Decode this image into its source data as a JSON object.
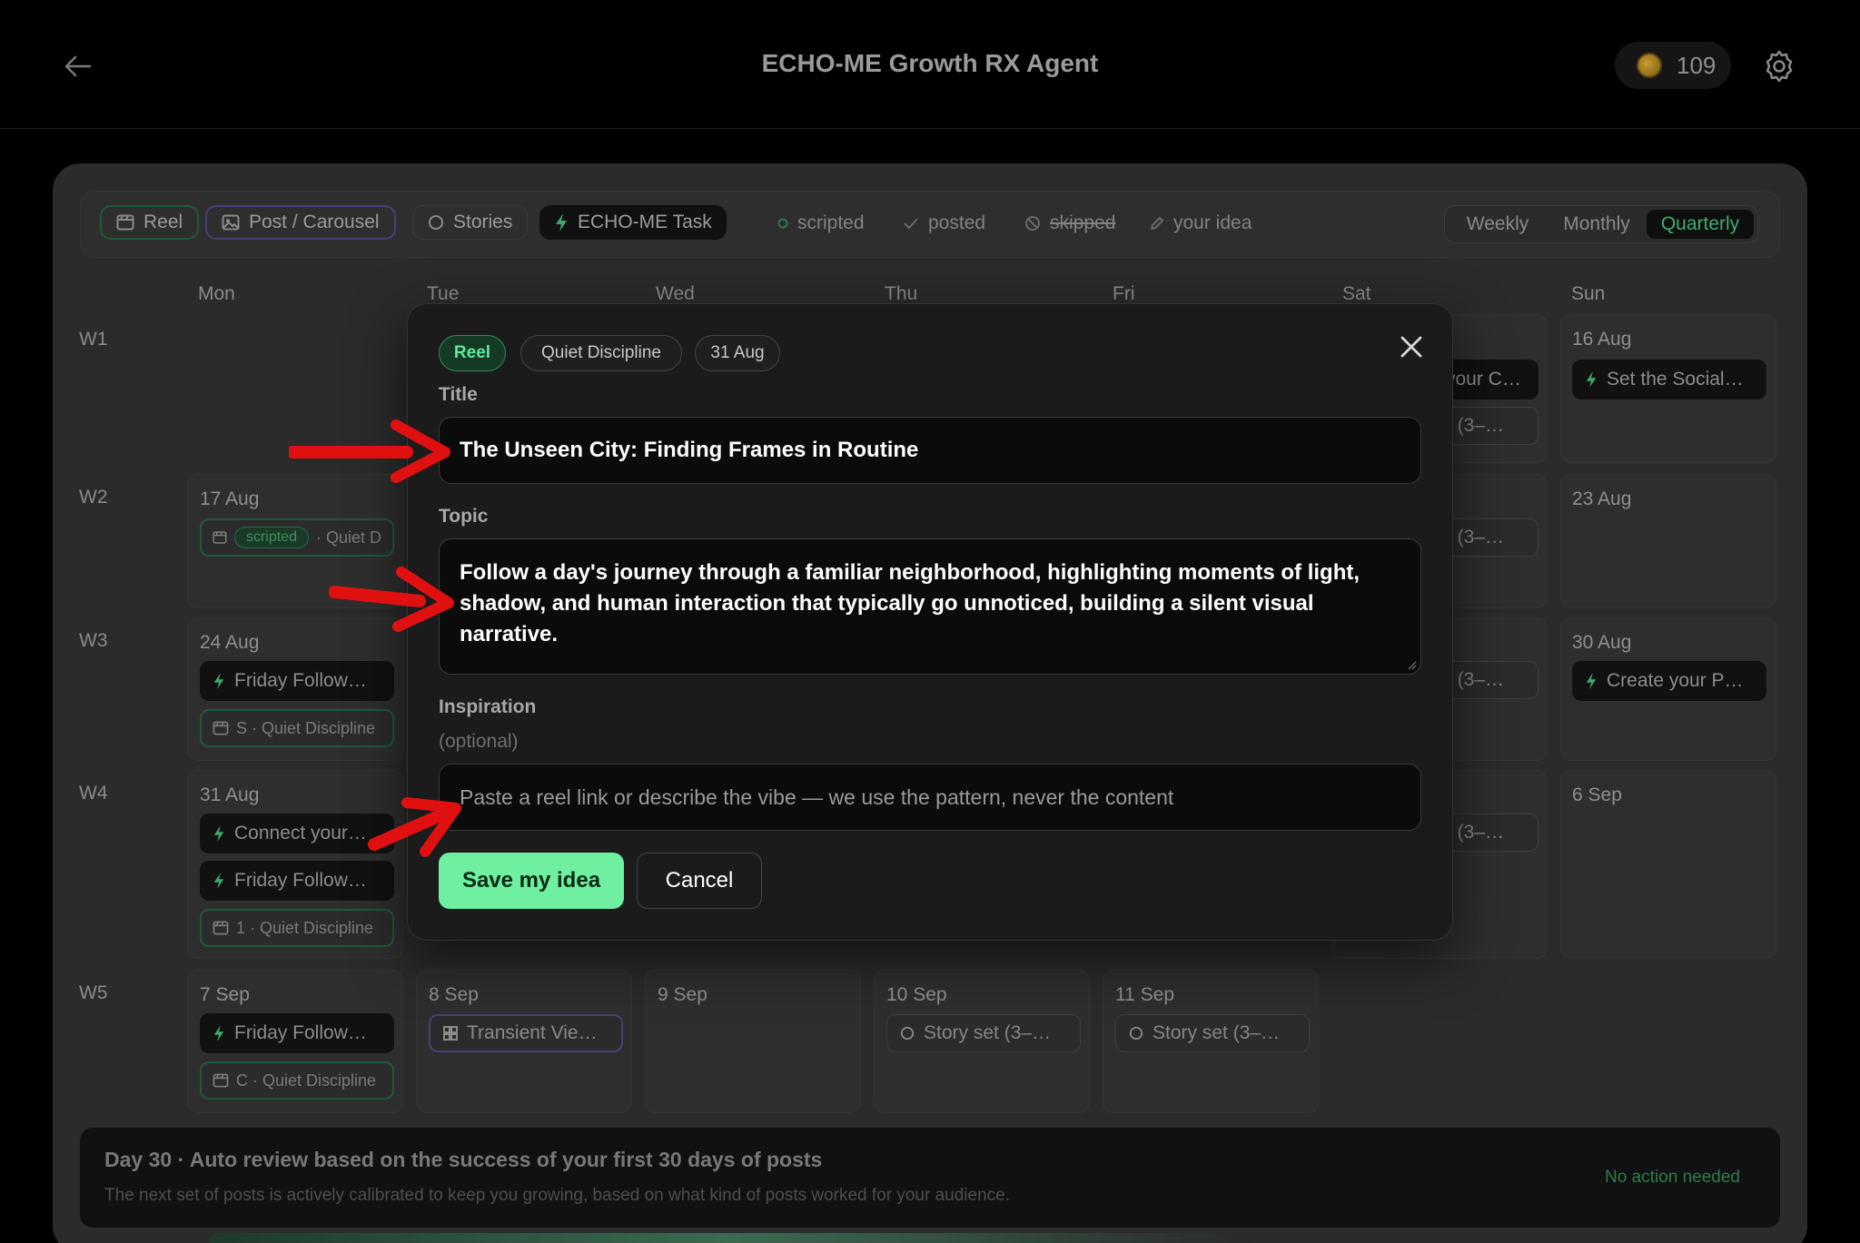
{
  "header": {
    "title": "ECHO-ME Growth RX Agent",
    "credits": "109"
  },
  "filters": {
    "types": [
      "Reel",
      "Post / Carousel",
      "Stories",
      "ECHO-ME Task"
    ],
    "legend": [
      "scripted",
      "posted",
      "skipped",
      "your idea"
    ],
    "views": [
      "Weekly",
      "Monthly",
      "Quarterly"
    ],
    "active_view": "Quarterly"
  },
  "calendar": {
    "days": [
      "Mon",
      "Tue",
      "Wed",
      "Thu",
      "Fri",
      "Sat",
      "Sun"
    ],
    "weeks": [
      "W1",
      "W2",
      "W3",
      "W4",
      "W5"
    ],
    "w1": {
      "sun_date": "16 Aug",
      "sun_task": "Set the Social…",
      "sat_task": "your C…",
      "sat_story": "t (3–…"
    },
    "w2": {
      "mon_date": "17 Aug",
      "mon_badge": "scripted",
      "mon_reel": "· Quiet D",
      "sat_story": "t (3–…",
      "sun_date": "23 Aug"
    },
    "w3": {
      "mon_date": "24 Aug",
      "mon_task": "Friday Follow…",
      "mon_reel": "S · Quiet Discipline",
      "sat_story": "t (3–…",
      "sun_date": "30 Aug",
      "sun_task": "Create your P…"
    },
    "w4": {
      "mon_date": "31 Aug",
      "mon_task1": "Connect your…",
      "mon_task2": "Friday Follow…",
      "mon_reel": "1 · Quiet Discipline",
      "sat_story": "t (3–…",
      "sun_date": "6 Sep"
    },
    "w5": {
      "mon_date": "7 Sep",
      "mon_task": "Friday Follow…",
      "mon_reel": "C · Quiet Discipline",
      "tue_date": "8 Sep",
      "tue_post": "Transient Vie…",
      "wed_date": "9 Sep",
      "thu_date": "10 Sep",
      "thu_story": "Story set (3–…",
      "fri_date": "11 Sep",
      "fri_story": "Story set (3–…"
    }
  },
  "banner": {
    "title": "Day 30 · Auto review based on the success of your first 30 days of posts",
    "subtitle": "The next set of posts is actively calibrated to keep you growing, based on what kind of posts worked for your audience.",
    "status": "No action needed"
  },
  "modal": {
    "tags": [
      "Reel",
      "Quiet Discipline",
      "31 Aug"
    ],
    "title_label": "Title",
    "title_value": "The Unseen City: Finding Frames in Routine",
    "topic_label": "Topic",
    "topic_value": "Follow a day's journey through a familiar neighborhood, highlighting moments of light, shadow, and human interaction that typically go unnoticed, building a silent visual narrative.",
    "inspiration_label": "Inspiration",
    "inspiration_optional": "(optional)",
    "inspiration_placeholder": "Paste a reel link or describe the vibe — we use the pattern, never the content",
    "save_label": "Save my idea",
    "cancel_label": "Cancel"
  },
  "colors": {
    "accent": "#6ef0a0",
    "annotation_arrow": "#e01010"
  },
  "icons": [
    "back-arrow-icon",
    "coin-icon",
    "gear-icon",
    "reel-icon",
    "post-icon",
    "story-icon",
    "bolt-icon",
    "check-icon",
    "skip-icon",
    "pencil-icon",
    "close-icon"
  ]
}
